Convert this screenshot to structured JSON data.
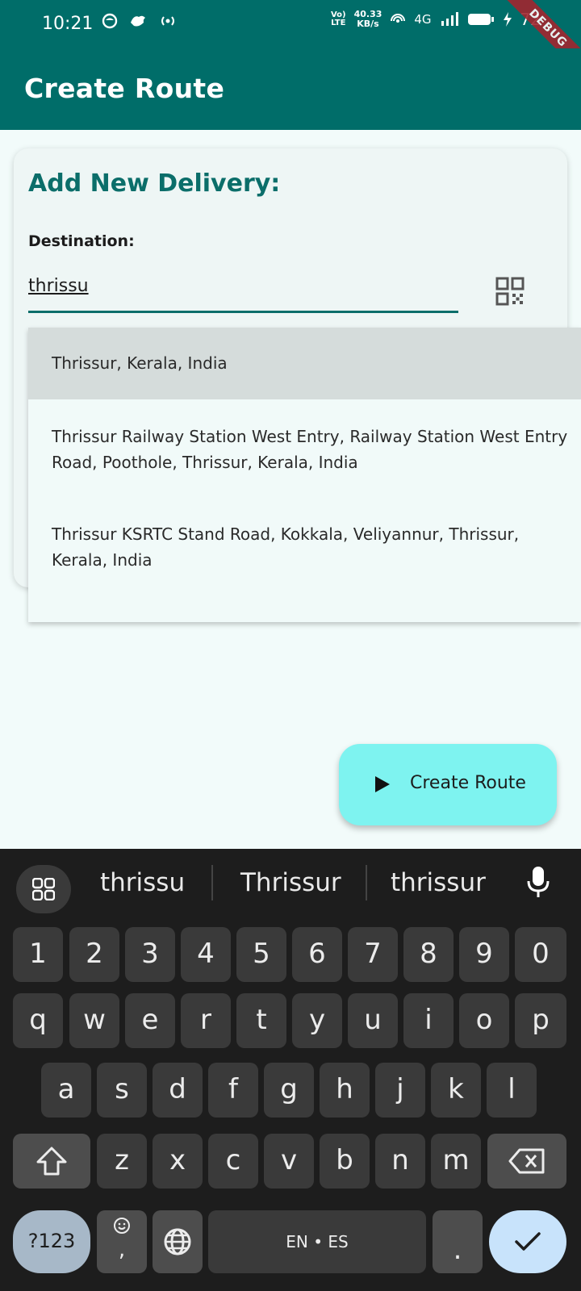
{
  "status_bar": {
    "time": "10:21",
    "volte_top": "Vo)",
    "volte_bottom": "LTE",
    "speed_value": "40.33",
    "speed_unit": "KB/s",
    "network": "4G",
    "battery": "72",
    "debug_banner": "DEBUG"
  },
  "app_bar": {
    "title": "Create Route"
  },
  "card": {
    "title": "Add New Delivery:",
    "destination_label": "Destination:",
    "destination_value": "thrissu"
  },
  "suggestions": [
    "Thrissur, Kerala, India",
    "Thrissur Railway Station West Entry, Railway Station West Entry Road, Poothole, Thrissur, Kerala, India",
    "Thrissur KSRTC Stand Road, Kokkala, Veliyannur, Thrissur, Kerala, India"
  ],
  "fab": {
    "label": "Create Route"
  },
  "keyboard": {
    "suggestions": [
      "thrissu",
      "Thrissur",
      "thrissur"
    ],
    "row_numbers": [
      "1",
      "2",
      "3",
      "4",
      "5",
      "6",
      "7",
      "8",
      "9",
      "0"
    ],
    "row_q": [
      "q",
      "w",
      "e",
      "r",
      "t",
      "y",
      "u",
      "i",
      "o",
      "p"
    ],
    "row_a": [
      "a",
      "s",
      "d",
      "f",
      "g",
      "h",
      "j",
      "k",
      "l"
    ],
    "row_z": [
      "z",
      "x",
      "c",
      "v",
      "b",
      "n",
      "m"
    ],
    "symbols_label": "?123",
    "comma_label": ",",
    "space_label": "EN • ES",
    "period_label": "."
  },
  "colors": {
    "primary": "#006d69",
    "fab": "#7ef3f0",
    "background": "#f2fbfa"
  }
}
